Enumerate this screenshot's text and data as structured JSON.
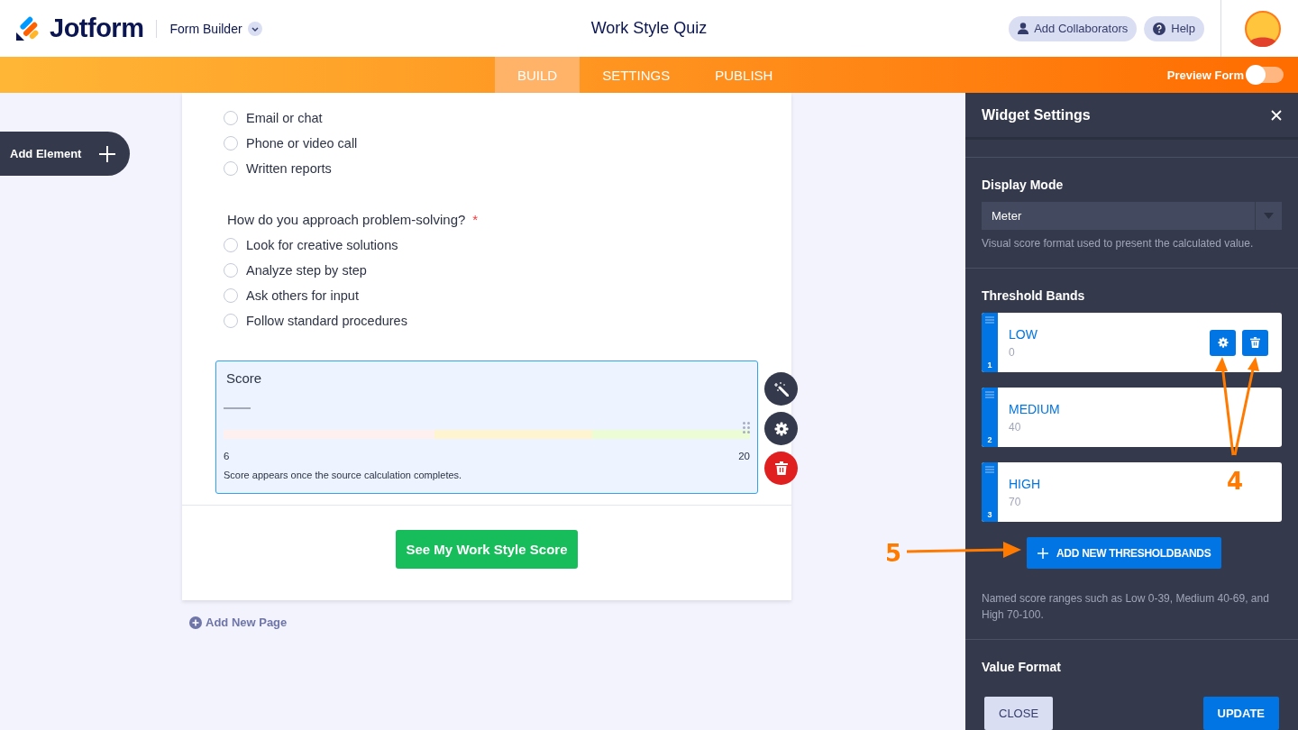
{
  "header": {
    "brand": "Jotform",
    "product": "Form Builder",
    "title": "Work Style Quiz",
    "actions": [
      {
        "label": "Add Collaborators",
        "kind": "user"
      },
      {
        "label": "Help",
        "kind": "help"
      }
    ]
  },
  "nav": {
    "tabs": [
      {
        "label": "BUILD",
        "selected": true
      },
      {
        "label": "SETTINGS",
        "selected": false
      },
      {
        "label": "PUBLISH",
        "selected": false
      }
    ],
    "preview": {
      "label": "Preview Form",
      "on": false
    }
  },
  "sidebar": {
    "add_element": "Add Element"
  },
  "form": {
    "questions": [
      {
        "options": [
          {
            "label": "Email or chat",
            "checked": false
          },
          {
            "label": "Phone or video call",
            "checked": false
          },
          {
            "label": "Written reports",
            "checked": false
          }
        ]
      },
      {
        "label": "How do you approach problem-solving?",
        "required_mark": "*",
        "options": [
          {
            "label": "Look for creative solutions",
            "checked": false
          },
          {
            "label": "Analyze step by step",
            "checked": false
          },
          {
            "label": "Ask others for input",
            "checked": false
          },
          {
            "label": "Follow standard procedures",
            "checked": false
          }
        ]
      }
    ],
    "score_field": {
      "label": "Score",
      "selected": true,
      "bands": [
        {
          "color": "#fff0f0"
        },
        {
          "color": "#fff4d0"
        },
        {
          "color": "#ecfdd6"
        }
      ],
      "min": "6",
      "max": "20",
      "note": "Score appears once the source calculation completes."
    },
    "submit": "See My Work Style Score",
    "add_page": "Add New Page"
  },
  "panel": {
    "title": "Widget Settings",
    "display_mode": {
      "label": "Display Mode",
      "value": "Meter",
      "help": "Visual score format used to present the calculated value."
    },
    "threshold_bands": {
      "label": "Threshold Bands",
      "items": [
        {
          "index": "1",
          "name": "LOW",
          "value": "0",
          "hovered": true
        },
        {
          "index": "2",
          "name": "MEDIUM",
          "value": "40",
          "hovered": false
        },
        {
          "index": "3",
          "name": "HIGH",
          "value": "70",
          "hovered": false
        }
      ],
      "add_button": "ADD NEW THRESHOLDBANDS",
      "help": "Named score ranges such as Low 0-39, Medium 40-69, and High 70-100."
    },
    "value_format": {
      "label": "Value Format"
    },
    "buttons": [
      {
        "label": "CLOSE",
        "kind": "secondary"
      },
      {
        "label": "UPDATE",
        "kind": "primary"
      }
    ]
  },
  "annotations": [
    {
      "label": "4"
    },
    {
      "label": "5"
    }
  ]
}
